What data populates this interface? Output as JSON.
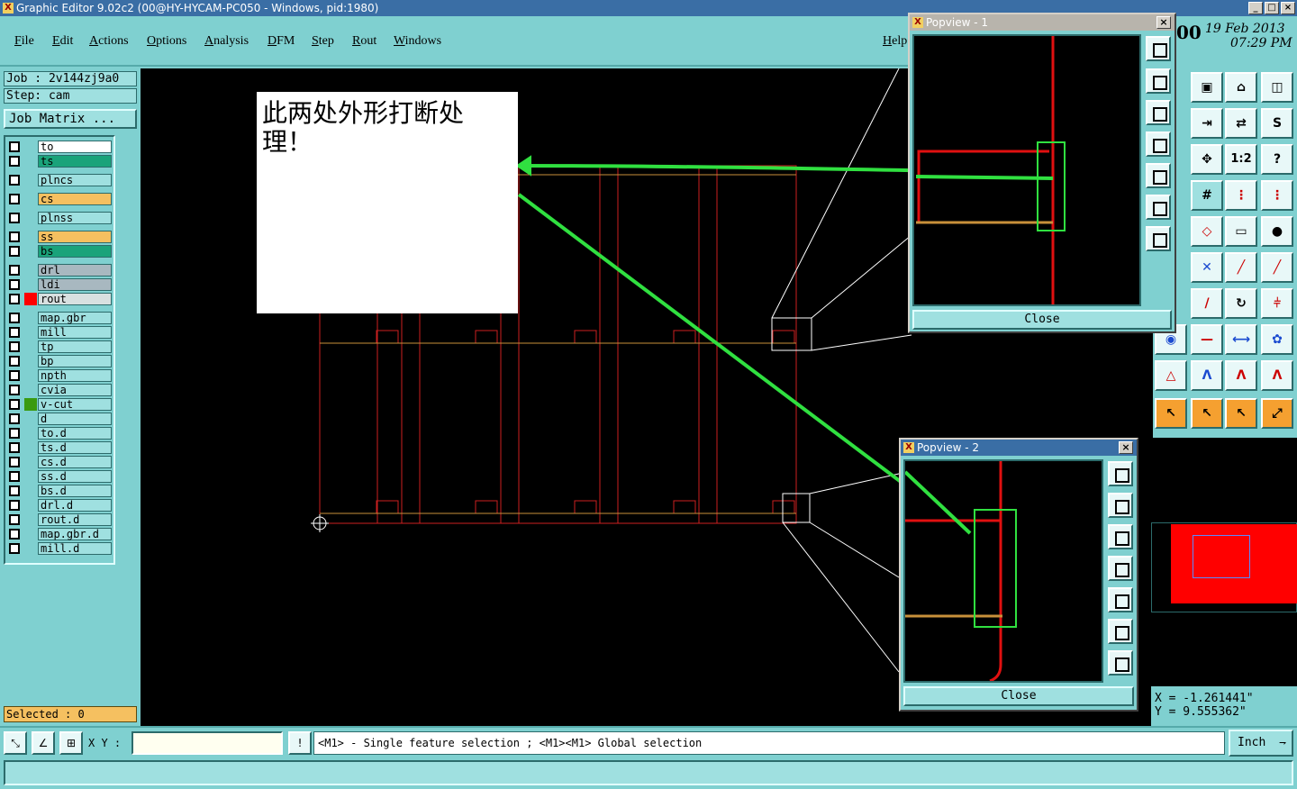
{
  "window": {
    "title": "Graphic Editor 9.02c2 (00@HY-HYCAM-PC050 - Windows, pid:1980)"
  },
  "menu": {
    "items": [
      "File",
      "Edit",
      "Actions",
      "Options",
      "Analysis",
      "DFM",
      "Step",
      "Rout",
      "Windows"
    ],
    "help": "Help"
  },
  "clock": {
    "time_hint": "00",
    "date": "19 Feb 2013",
    "time": "07:29 PM"
  },
  "job": {
    "job_line": "Job : 2v144zj9a0",
    "step_line": "Step: cam",
    "matrix_button": "Job Matrix ..."
  },
  "layers": [
    {
      "name": "to",
      "color": "#ffffff",
      "swatch": ""
    },
    {
      "name": "ts",
      "color": "#1aa37a",
      "swatch": ""
    },
    {
      "name": "plncs",
      "color": "#9fe0e0",
      "swatch": ""
    },
    {
      "name": "cs",
      "color": "#f5c060",
      "swatch": ""
    },
    {
      "name": "plnss",
      "color": "#9fe0e0",
      "swatch": ""
    },
    {
      "name": "ss",
      "color": "#f5c060",
      "swatch": ""
    },
    {
      "name": "bs",
      "color": "#1aa37a",
      "swatch": ""
    },
    {
      "name": "drl",
      "color": "#a8b8c0",
      "swatch": ""
    },
    {
      "name": "ldi",
      "color": "#a8b8c0",
      "swatch": ""
    },
    {
      "name": "rout",
      "color": "#d8e0e0",
      "swatch": "#ff0000"
    },
    {
      "name": "map.gbr",
      "color": "#9fe0e0",
      "swatch": ""
    },
    {
      "name": "mill",
      "color": "#9fe0e0",
      "swatch": ""
    },
    {
      "name": "tp",
      "color": "#9fe0e0",
      "swatch": ""
    },
    {
      "name": "bp",
      "color": "#9fe0e0",
      "swatch": ""
    },
    {
      "name": "npth",
      "color": "#9fe0e0",
      "swatch": ""
    },
    {
      "name": "cvia",
      "color": "#9fe0e0",
      "swatch": ""
    },
    {
      "name": "v-cut",
      "color": "#9fe0e0",
      "swatch": "#3a9a10"
    },
    {
      "name": "d",
      "color": "#9fe0e0",
      "swatch": ""
    },
    {
      "name": "to.d",
      "color": "#9fe0e0",
      "swatch": ""
    },
    {
      "name": "ts.d",
      "color": "#9fe0e0",
      "swatch": ""
    },
    {
      "name": "cs.d",
      "color": "#9fe0e0",
      "swatch": ""
    },
    {
      "name": "ss.d",
      "color": "#9fe0e0",
      "swatch": ""
    },
    {
      "name": "bs.d",
      "color": "#9fe0e0",
      "swatch": ""
    },
    {
      "name": "drl.d",
      "color": "#9fe0e0",
      "swatch": ""
    },
    {
      "name": "rout.d",
      "color": "#9fe0e0",
      "swatch": ""
    },
    {
      "name": "map.gbr.d",
      "color": "#9fe0e0",
      "swatch": ""
    },
    {
      "name": "mill.d",
      "color": "#9fe0e0",
      "swatch": ""
    }
  ],
  "selected": "Selected : 0",
  "note": {
    "text": "此两处外形打断处理！"
  },
  "popview1": {
    "title": "Popview - 1",
    "close": "Close"
  },
  "popview2": {
    "title": "Popview - 2",
    "close": "Close"
  },
  "coords": {
    "x": "X = -1.261441\"",
    "y": "Y = 9.555362\""
  },
  "bottom": {
    "xy_label": "X Y :",
    "xy_value": "",
    "help": "<M1> - Single feature selection ; <M1><M1> Global selection",
    "units": "Inch"
  },
  "tools": [
    "1:2",
    "?"
  ]
}
